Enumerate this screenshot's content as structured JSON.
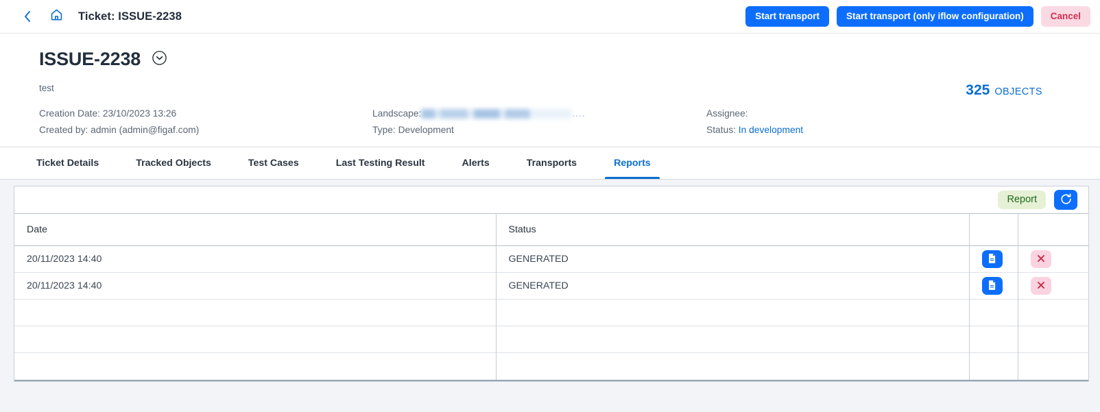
{
  "shell": {
    "back_icon": "chevron-left-icon",
    "home_icon": "home-icon",
    "title": "Ticket: ISSUE-2238",
    "actions": [
      {
        "label": "Start transport",
        "style": "primary"
      },
      {
        "label": "Start transport (only iflow configuration)",
        "style": "primary"
      },
      {
        "label": "Cancel",
        "style": "danger-ghost"
      }
    ]
  },
  "object_header": {
    "title": "ISSUE-2238",
    "toggle_icon": "chevron-down-circle-icon",
    "subtitle": "test",
    "count_value": "325",
    "count_label": "OBJECTS",
    "meta": {
      "creation_date_label": "Creation Date:",
      "creation_date_value": "23/10/2023 13:26",
      "created_by_label": "Created by:",
      "created_by_value": "admin (admin@figaf.com)",
      "landscape_label": "Landscape:",
      "landscape_value": "",
      "landscape_truncation": "....",
      "type_label": "Type:",
      "type_value": "Development",
      "assignee_label": "Assignee:",
      "assignee_value": "",
      "status_label": "Status:",
      "status_value": "In development"
    }
  },
  "tabs": [
    {
      "label": "Ticket Details",
      "active": false
    },
    {
      "label": "Tracked Objects",
      "active": false
    },
    {
      "label": "Test Cases",
      "active": false
    },
    {
      "label": "Last Testing Result",
      "active": false
    },
    {
      "label": "Alerts",
      "active": false
    },
    {
      "label": "Transports",
      "active": false
    },
    {
      "label": "Reports",
      "active": true
    }
  ],
  "reports_tab": {
    "toolbar": {
      "report_button": "Report",
      "refresh_icon": "refresh-icon"
    },
    "table": {
      "columns": [
        "Date",
        "Status",
        "",
        ""
      ],
      "rows": [
        {
          "date": "20/11/2023 14:40",
          "status": "GENERATED",
          "view_icon": "document-icon",
          "delete_icon": "close-icon"
        },
        {
          "date": "20/11/2023 14:40",
          "status": "GENERATED",
          "view_icon": "document-icon",
          "delete_icon": "close-icon"
        },
        {
          "date": "",
          "status": "",
          "view_icon": "",
          "delete_icon": ""
        },
        {
          "date": "",
          "status": "",
          "view_icon": "",
          "delete_icon": ""
        },
        {
          "date": "",
          "status": "",
          "view_icon": "",
          "delete_icon": ""
        }
      ]
    }
  },
  "colors": {
    "accent": "#0a6ed1",
    "primary_button": "#0d6efd",
    "danger": "#d32f4e",
    "danger_bg": "#fbd9e3",
    "report_bg": "#e6f0d4",
    "report_text": "#1e6b1e",
    "page_bg": "#f2f4f7"
  }
}
